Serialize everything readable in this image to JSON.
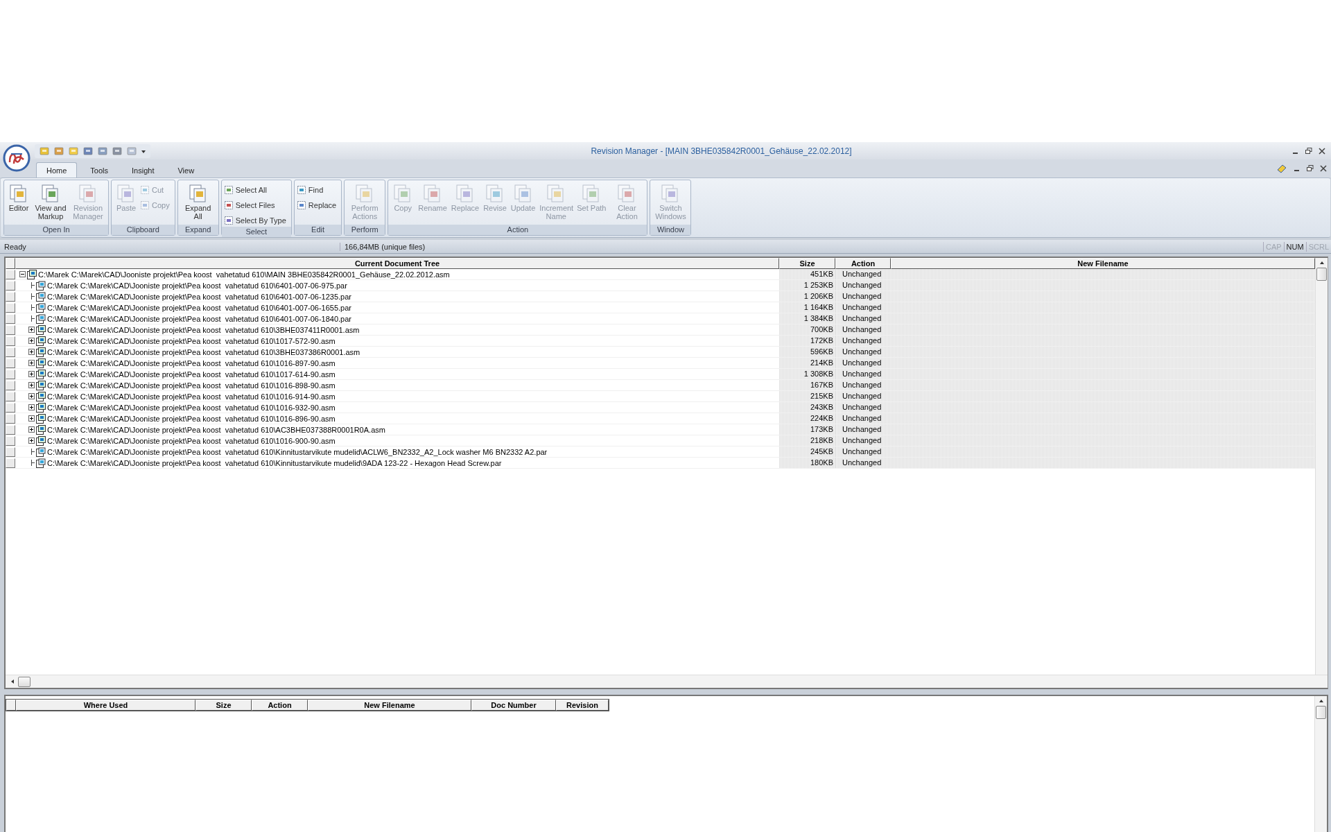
{
  "window": {
    "title": "Revision Manager - [MAIN 3BHE035842R0001_Gehäuse_22.02.2012]"
  },
  "ribbon": {
    "tabs": [
      {
        "label": "Home",
        "selected": true
      },
      {
        "label": "Tools",
        "selected": false
      },
      {
        "label": "Insight",
        "selected": false
      },
      {
        "label": "View",
        "selected": false
      }
    ],
    "groups": [
      {
        "label": "Open In",
        "buttons": [
          {
            "label": "Editor",
            "kind": "large",
            "disabled": false
          },
          {
            "label": "View and Markup",
            "kind": "large",
            "disabled": false
          },
          {
            "label": "Revision Manager",
            "kind": "large",
            "disabled": true
          }
        ]
      },
      {
        "label": "Clipboard",
        "buttons": [
          {
            "label": "Paste",
            "kind": "large",
            "disabled": true
          },
          {
            "label": "Cut",
            "kind": "small",
            "disabled": true
          },
          {
            "label": "Copy",
            "kind": "small",
            "disabled": true
          }
        ]
      },
      {
        "label": "Expand",
        "buttons": [
          {
            "label": "Expand All",
            "kind": "large",
            "disabled": false
          }
        ]
      },
      {
        "label": "Select",
        "buttons": [
          {
            "label": "Select All",
            "kind": "small",
            "disabled": false
          },
          {
            "label": "Select Files",
            "kind": "small",
            "disabled": false
          },
          {
            "label": "Select By Type",
            "kind": "small",
            "disabled": false
          }
        ]
      },
      {
        "label": "Edit",
        "buttons": [
          {
            "label": "Find",
            "kind": "small",
            "disabled": false
          },
          {
            "label": "Replace",
            "kind": "small",
            "disabled": false
          }
        ]
      },
      {
        "label": "Perform",
        "buttons": [
          {
            "label": "Perform Actions",
            "kind": "large",
            "disabled": true
          }
        ]
      },
      {
        "label": "Action",
        "buttons": [
          {
            "label": "Copy",
            "kind": "large",
            "disabled": true
          },
          {
            "label": "Rename",
            "kind": "large",
            "disabled": true
          },
          {
            "label": "Replace",
            "kind": "large",
            "disabled": true
          },
          {
            "label": "Revise",
            "kind": "large",
            "disabled": true
          },
          {
            "label": "Update",
            "kind": "large",
            "disabled": true
          },
          {
            "label": "Increment Name",
            "kind": "large",
            "disabled": true
          },
          {
            "label": "Set Path",
            "kind": "large",
            "disabled": true
          },
          {
            "label": "Clear Action",
            "kind": "large",
            "disabled": true
          }
        ]
      },
      {
        "label": "Window",
        "buttons": [
          {
            "label": "Switch Windows",
            "kind": "large",
            "disabled": true
          }
        ]
      }
    ]
  },
  "status_bar": {
    "message": "Ready",
    "info": "166,84MB (unique files)",
    "indicators": [
      {
        "label": "CAP",
        "on": false
      },
      {
        "label": "NUM",
        "on": true
      },
      {
        "label": "SCRL",
        "on": false
      }
    ]
  },
  "tree": {
    "columns": [
      "Current Document Tree",
      "Size",
      "Action",
      "New Filename"
    ],
    "rows": [
      {
        "name": "C:\\Marek C:\\Marek\\CAD\\Jooniste projekt\\Pea koost  vahetatud 610\\MAIN 3BHE035842R0001_Gehäuse_22.02.2012.asm",
        "kind": "assembly",
        "expanded": true,
        "size": "451KB",
        "action": "Unchanged",
        "children": [
          {
            "name": "C:\\Marek C:\\Marek\\CAD\\Jooniste projekt\\Pea koost  vahetatud 610\\6401-007-06-975.par",
            "kind": "part",
            "size": "1 253KB",
            "action": "Unchanged"
          },
          {
            "name": "C:\\Marek C:\\Marek\\CAD\\Jooniste projekt\\Pea koost  vahetatud 610\\6401-007-06-1235.par",
            "kind": "part",
            "size": "1 206KB",
            "action": "Unchanged"
          },
          {
            "name": "C:\\Marek C:\\Marek\\CAD\\Jooniste projekt\\Pea koost  vahetatud 610\\6401-007-06-1655.par",
            "kind": "part",
            "size": "1 164KB",
            "action": "Unchanged"
          },
          {
            "name": "C:\\Marek C:\\Marek\\CAD\\Jooniste projekt\\Pea koost  vahetatud 610\\6401-007-06-1840.par",
            "kind": "part",
            "size": "1 384KB",
            "action": "Unchanged"
          },
          {
            "name": "C:\\Marek C:\\Marek\\CAD\\Jooniste projekt\\Pea koost  vahetatud 610\\3BHE037411R0001.asm",
            "kind": "assembly",
            "expanded": false,
            "size": "700KB",
            "action": "Unchanged"
          },
          {
            "name": "C:\\Marek C:\\Marek\\CAD\\Jooniste projekt\\Pea koost  vahetatud 610\\1017-572-90.asm",
            "kind": "assembly",
            "expanded": false,
            "size": "172KB",
            "action": "Unchanged"
          },
          {
            "name": "C:\\Marek C:\\Marek\\CAD\\Jooniste projekt\\Pea koost  vahetatud 610\\3BHE037386R0001.asm",
            "kind": "assembly",
            "expanded": false,
            "size": "596KB",
            "action": "Unchanged"
          },
          {
            "name": "C:\\Marek C:\\Marek\\CAD\\Jooniste projekt\\Pea koost  vahetatud 610\\1016-897-90.asm",
            "kind": "assembly",
            "expanded": false,
            "size": "214KB",
            "action": "Unchanged"
          },
          {
            "name": "C:\\Marek C:\\Marek\\CAD\\Jooniste projekt\\Pea koost  vahetatud 610\\1017-614-90.asm",
            "kind": "assembly",
            "expanded": false,
            "size": "1 308KB",
            "action": "Unchanged"
          },
          {
            "name": "C:\\Marek C:\\Marek\\CAD\\Jooniste projekt\\Pea koost  vahetatud 610\\1016-898-90.asm",
            "kind": "assembly",
            "expanded": false,
            "size": "167KB",
            "action": "Unchanged"
          },
          {
            "name": "C:\\Marek C:\\Marek\\CAD\\Jooniste projekt\\Pea koost  vahetatud 610\\1016-914-90.asm",
            "kind": "assembly",
            "expanded": false,
            "size": "215KB",
            "action": "Unchanged"
          },
          {
            "name": "C:\\Marek C:\\Marek\\CAD\\Jooniste projekt\\Pea koost  vahetatud 610\\1016-932-90.asm",
            "kind": "assembly",
            "expanded": false,
            "size": "243KB",
            "action": "Unchanged"
          },
          {
            "name": "C:\\Marek C:\\Marek\\CAD\\Jooniste projekt\\Pea koost  vahetatud 610\\1016-896-90.asm",
            "kind": "assembly",
            "expanded": false,
            "size": "224KB",
            "action": "Unchanged"
          },
          {
            "name": "C:\\Marek C:\\Marek\\CAD\\Jooniste projekt\\Pea koost  vahetatud 610\\AC3BHE037388R0001R0A.asm",
            "kind": "assembly",
            "expanded": false,
            "size": "173KB",
            "action": "Unchanged"
          },
          {
            "name": "C:\\Marek C:\\Marek\\CAD\\Jooniste projekt\\Pea koost  vahetatud 610\\1016-900-90.asm",
            "kind": "assembly",
            "expanded": false,
            "size": "218KB",
            "action": "Unchanged"
          },
          {
            "name": "C:\\Marek C:\\Marek\\CAD\\Jooniste projekt\\Pea koost  vahetatud 610\\Kinnitustarvikute mudelid\\ACLW6_BN2332_A2_Lock washer M6 BN2332 A2.par",
            "kind": "part",
            "size": "245KB",
            "action": "Unchanged"
          },
          {
            "name": "C:\\Marek C:\\Marek\\CAD\\Jooniste projekt\\Pea koost  vahetatud 610\\Kinnitustarvikute mudelid\\9ADA 123-22 - Hexagon Head Screw.par",
            "kind": "part",
            "size": "180KB",
            "action": "Unchanged"
          }
        ]
      }
    ]
  },
  "where_used": {
    "columns": [
      "Where Used",
      "Size",
      "Action",
      "New Filename",
      "Doc Number",
      "Revision"
    ]
  }
}
